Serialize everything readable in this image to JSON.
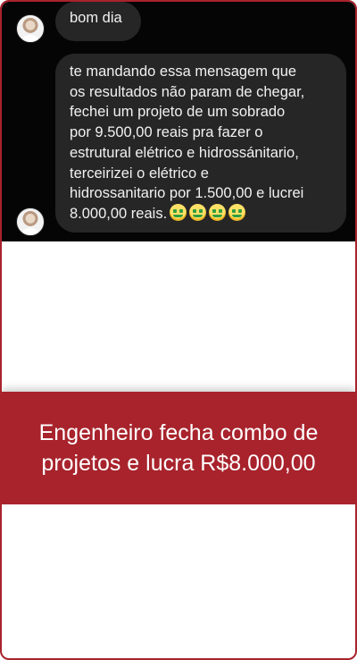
{
  "chat": {
    "messages": [
      {
        "text": "bom dia"
      },
      {
        "lines": [
          "te mandando essa mensagem que",
          "os resultados não param de chegar,",
          "fechei um projeto de um sobrado",
          "por 9.500,00 reais pra fazer o",
          "estrutural elétrico e hidrossánitario,",
          "terceirizei o elétrico e",
          "hidrossanitario por 1.500,00 e lucrei",
          "8.000,00 reais."
        ],
        "emojis": [
          "money-mouth-face-icon",
          "money-mouth-face-icon",
          "money-mouth-face-icon",
          "money-mouth-face-icon"
        ]
      }
    ]
  },
  "banner": {
    "title": "Engenheiro fecha combo de projetos e lucra R$8.000,00",
    "background": "#a8232c"
  },
  "colors": {
    "frame_border": "#a8232c",
    "chat_background": "#050505",
    "bubble_background": "#262626"
  }
}
